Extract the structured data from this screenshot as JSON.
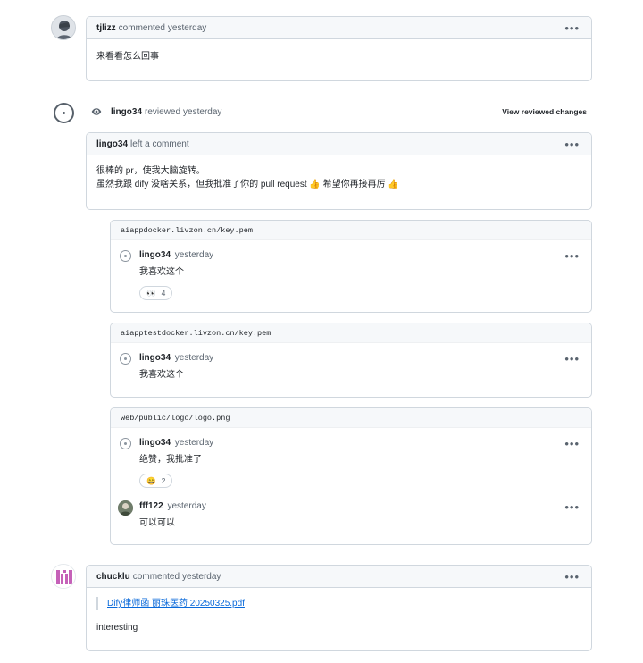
{
  "comments": [
    {
      "author": "tjlizz",
      "action": "commented",
      "time": "yesterday",
      "body": "来看看怎么回事"
    }
  ],
  "review": {
    "author": "lingo34",
    "action": "reviewed",
    "time": "yesterday",
    "view_changes_label": "View reviewed changes",
    "comment_author": "lingo34",
    "comment_action": "left a comment",
    "comment_line1": "很棒的 pr，使我大脑旋转。",
    "comment_line2": "虽然我跟 dify 没啥关系，但我批准了你的 pull request 👍 希望你再接再厉 👍"
  },
  "threads": [
    {
      "path": "aiappdocker.livzon.cn/key.pem",
      "comments": [
        {
          "author": "lingo34",
          "time": "yesterday",
          "text": "我喜欢这个",
          "reaction_emoji": "👀",
          "reaction_count": "4"
        }
      ]
    },
    {
      "path": "aiapptestdocker.livzon.cn/key.pem",
      "comments": [
        {
          "author": "lingo34",
          "time": "yesterday",
          "text": "我喜欢这个"
        }
      ]
    },
    {
      "path": "web/public/logo/logo.png",
      "comments": [
        {
          "author": "lingo34",
          "time": "yesterday",
          "text": "绝赞，我批准了",
          "reaction_emoji": "😄",
          "reaction_count": "2"
        },
        {
          "author": "fff122",
          "time": "yesterday",
          "text": "可以可以"
        }
      ]
    }
  ],
  "last_comment": {
    "author": "chucklu",
    "action": "commented",
    "time": "yesterday",
    "attachment_link": "Dify律师函 丽珠医药 20250325.pdf",
    "body": "interesting"
  },
  "icons": {
    "kebab": "kebab-horizontal-icon",
    "eye": "eye-icon",
    "review_badge": "review-badge-icon"
  },
  "colors": {
    "border": "#d0d7de",
    "header_bg": "#f6f8fa",
    "link": "#0969da",
    "muted": "#59636e"
  }
}
